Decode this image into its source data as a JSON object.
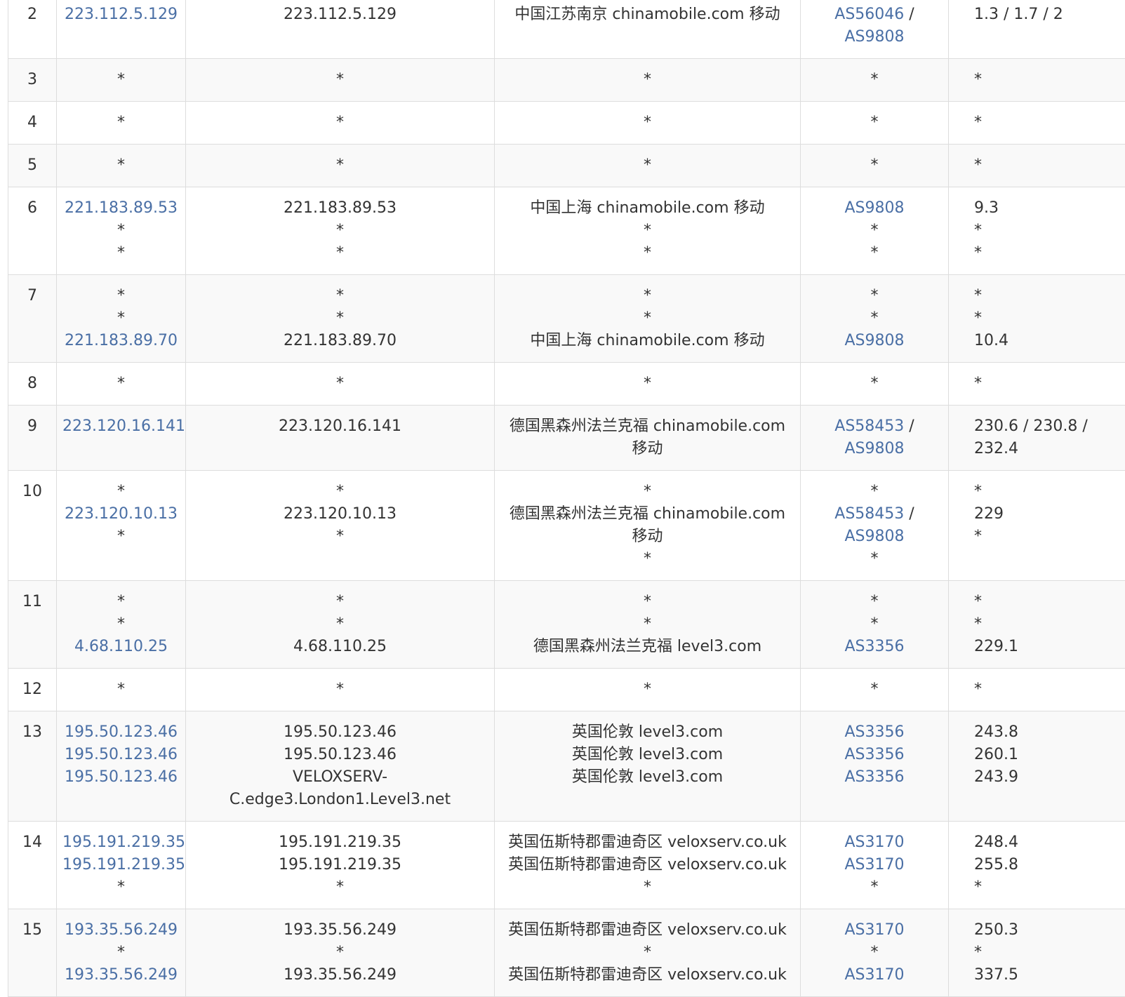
{
  "rows": [
    {
      "hop": "2",
      "ip": [
        {
          "t": "223.112.5.129",
          "link": true
        }
      ],
      "host": [
        "223.112.5.129"
      ],
      "location": [
        "中国江苏南京 chinamobile.com 移动"
      ],
      "asn": [
        {
          "t": "AS56046",
          "link": true,
          "suffix": " /"
        },
        {
          "t": "AS9808",
          "link": true
        }
      ],
      "rtt": [
        "1.3 / 1.7 / 2"
      ]
    },
    {
      "hop": "3",
      "ip": [
        {
          "t": "*"
        }
      ],
      "host": [
        "*"
      ],
      "location": [
        "*"
      ],
      "asn": [
        {
          "t": "*"
        }
      ],
      "rtt": [
        "*"
      ]
    },
    {
      "hop": "4",
      "ip": [
        {
          "t": "*"
        }
      ],
      "host": [
        "*"
      ],
      "location": [
        "*"
      ],
      "asn": [
        {
          "t": "*"
        }
      ],
      "rtt": [
        "*"
      ]
    },
    {
      "hop": "5",
      "ip": [
        {
          "t": "*"
        }
      ],
      "host": [
        "*"
      ],
      "location": [
        "*"
      ],
      "asn": [
        {
          "t": "*"
        }
      ],
      "rtt": [
        "*"
      ]
    },
    {
      "hop": "6",
      "ip": [
        {
          "t": "221.183.89.53",
          "link": true
        },
        {
          "t": "*"
        },
        {
          "t": "*"
        }
      ],
      "host": [
        "221.183.89.53",
        "*",
        "*"
      ],
      "location": [
        "中国上海 chinamobile.com 移动",
        "*",
        "*"
      ],
      "asn": [
        {
          "t": "AS9808",
          "link": true
        },
        {
          "t": "*"
        },
        {
          "t": "*"
        }
      ],
      "rtt": [
        "9.3",
        "*",
        "*"
      ]
    },
    {
      "hop": "7",
      "ip": [
        {
          "t": "*"
        },
        {
          "t": "*"
        },
        {
          "t": "221.183.89.70",
          "link": true
        }
      ],
      "host": [
        "*",
        "*",
        "221.183.89.70"
      ],
      "location": [
        "*",
        "*",
        "中国上海 chinamobile.com 移动"
      ],
      "asn": [
        {
          "t": "*"
        },
        {
          "t": "*"
        },
        {
          "t": "AS9808",
          "link": true
        }
      ],
      "rtt": [
        "*",
        "*",
        "10.4"
      ]
    },
    {
      "hop": "8",
      "ip": [
        {
          "t": "*"
        }
      ],
      "host": [
        "*"
      ],
      "location": [
        "*"
      ],
      "asn": [
        {
          "t": "*"
        }
      ],
      "rtt": [
        "*"
      ]
    },
    {
      "hop": "9",
      "ip": [
        {
          "t": "223.120.16.141",
          "link": true
        }
      ],
      "host": [
        "223.120.16.141"
      ],
      "location": [
        "德国黑森州法兰克福 chinamobile.com",
        "移动"
      ],
      "asn": [
        {
          "t": "AS58453",
          "link": true,
          "suffix": " /"
        },
        {
          "t": "AS9808",
          "link": true
        }
      ],
      "rtt": [
        "230.6 / 230.8 /",
        "232.4"
      ]
    },
    {
      "hop": "10",
      "ip": [
        {
          "t": "*"
        },
        {
          "t": "223.120.10.13",
          "link": true
        },
        {
          "t": "*"
        }
      ],
      "host": [
        "*",
        "223.120.10.13",
        "*"
      ],
      "location": [
        "*",
        "德国黑森州法兰克福 chinamobile.com",
        "移动",
        "*"
      ],
      "asn": [
        {
          "t": "*"
        },
        {
          "t": "AS58453",
          "link": true,
          "suffix": " /"
        },
        {
          "t": "AS9808",
          "link": true
        },
        {
          "t": "*"
        }
      ],
      "rtt": [
        "*",
        "229",
        "*"
      ]
    },
    {
      "hop": "11",
      "ip": [
        {
          "t": "*"
        },
        {
          "t": "*"
        },
        {
          "t": "4.68.110.25",
          "link": true
        }
      ],
      "host": [
        "*",
        "*",
        "4.68.110.25"
      ],
      "location": [
        "*",
        "*",
        "德国黑森州法兰克福 level3.com"
      ],
      "asn": [
        {
          "t": "*"
        },
        {
          "t": "*"
        },
        {
          "t": "AS3356",
          "link": true
        }
      ],
      "rtt": [
        "*",
        "*",
        "229.1"
      ]
    },
    {
      "hop": "12",
      "ip": [
        {
          "t": "*"
        }
      ],
      "host": [
        "*"
      ],
      "location": [
        "*"
      ],
      "asn": [
        {
          "t": "*"
        }
      ],
      "rtt": [
        "*"
      ]
    },
    {
      "hop": "13",
      "ip": [
        {
          "t": "195.50.123.46",
          "link": true
        },
        {
          "t": "195.50.123.46",
          "link": true
        },
        {
          "t": "195.50.123.46",
          "link": true
        }
      ],
      "host": [
        "195.50.123.46",
        "195.50.123.46",
        "VELOXSERV-",
        "C.edge3.London1.Level3.net"
      ],
      "location": [
        "英国伦敦 level3.com",
        "英国伦敦 level3.com",
        "英国伦敦 level3.com"
      ],
      "asn": [
        {
          "t": "AS3356",
          "link": true
        },
        {
          "t": "AS3356",
          "link": true
        },
        {
          "t": "AS3356",
          "link": true
        }
      ],
      "rtt": [
        "243.8",
        "260.1",
        "243.9"
      ]
    },
    {
      "hop": "14",
      "ip": [
        {
          "t": "195.191.219.35",
          "link": true
        },
        {
          "t": "195.191.219.35",
          "link": true
        },
        {
          "t": "*"
        }
      ],
      "host": [
        "195.191.219.35",
        "195.191.219.35",
        "*"
      ],
      "location": [
        "英国伍斯特郡雷迪奇区 veloxserv.co.uk",
        "英国伍斯特郡雷迪奇区 veloxserv.co.uk",
        "*"
      ],
      "asn": [
        {
          "t": "AS3170",
          "link": true
        },
        {
          "t": "AS3170",
          "link": true
        },
        {
          "t": "*"
        }
      ],
      "rtt": [
        "248.4",
        "255.8",
        "*"
      ]
    },
    {
      "hop": "15",
      "ip": [
        {
          "t": "193.35.56.249",
          "link": true
        },
        {
          "t": "*"
        },
        {
          "t": "193.35.56.249",
          "link": true
        }
      ],
      "host": [
        "193.35.56.249",
        "*",
        "193.35.56.249"
      ],
      "location": [
        "英国伍斯特郡雷迪奇区 veloxserv.co.uk",
        "*",
        "英国伍斯特郡雷迪奇区 veloxserv.co.uk"
      ],
      "asn": [
        {
          "t": "AS3170",
          "link": true
        },
        {
          "t": "*"
        },
        {
          "t": "AS3170",
          "link": true
        }
      ],
      "rtt": [
        "250.3",
        "*",
        "337.5"
      ]
    }
  ],
  "colors": {
    "link": "#4a6fa5",
    "text": "#333333",
    "border": "#dddddd",
    "row_alt": "#f9f9f9"
  }
}
